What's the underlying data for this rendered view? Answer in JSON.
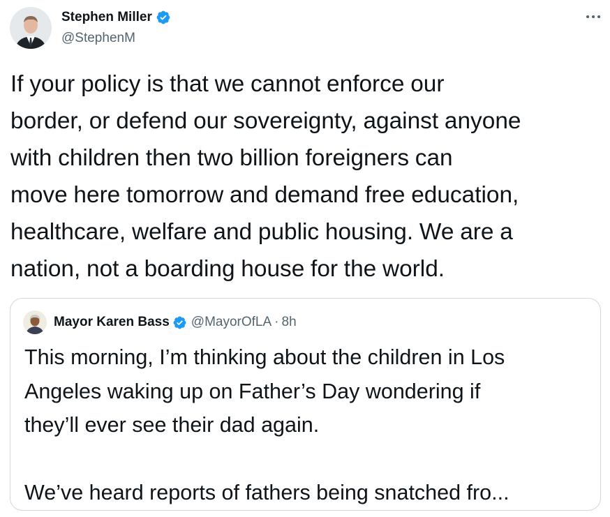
{
  "tweet": {
    "author": {
      "name": "Stephen Miller",
      "handle": "@StephenM",
      "verified": true
    },
    "more_icon": "more-horizontal-icon",
    "text": "If your policy is that we cannot enforce our\nborder, or defend our sovereignty, against anyone\nwith children then two billion foreigners can\nmove here tomorrow and demand free education,\nhealthcare, welfare and public housing. We are a\nnation, not a boarding house for the world.",
    "quoted": {
      "author": {
        "name": "Mayor Karen Bass",
        "handle": "@MayorOfLA",
        "verified": true
      },
      "separator": "·",
      "time": "8h",
      "text": "This morning, I’m thinking about the children in Los\nAngeles waking up on Father’s Day wondering if\nthey’ll ever see their dad again.\n\nWe’ve heard reports of fathers being snatched fro..."
    }
  },
  "colors": {
    "verified_badge": "#1d9bf0",
    "text_primary": "#0f1419",
    "text_secondary": "#536471",
    "border": "#cfd9de"
  }
}
